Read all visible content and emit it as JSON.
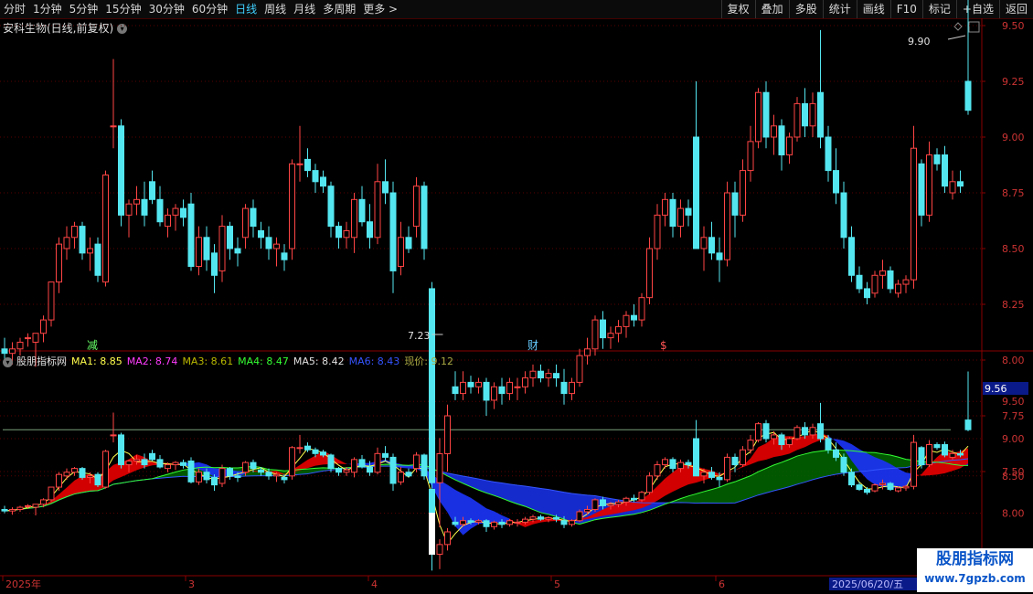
{
  "toolbar": {
    "periods": [
      "分时",
      "1分钟",
      "5分钟",
      "15分钟",
      "30分钟",
      "60分钟",
      "日线",
      "周线",
      "月线",
      "多周期",
      "更多 >"
    ],
    "active_period": "日线",
    "right_buttons": [
      "复权",
      "叠加",
      "多股",
      "统计",
      "画线",
      "F10",
      "标记",
      "+自选",
      "返回"
    ]
  },
  "main_title": "安科生物(日线,前复权)",
  "sub_indicator": {
    "name": "股朋指标网",
    "labels": [
      {
        "text": "MA1: 8.85",
        "color": "#ffff4d"
      },
      {
        "text": "MA2: 8.74",
        "color": "#ff3cff"
      },
      {
        "text": "MA3: 8.61",
        "color": "#b8b800"
      },
      {
        "text": "MA4: 8.47",
        "color": "#33ff33"
      },
      {
        "text": "MA5: 8.42",
        "color": "#e0e0e0"
      },
      {
        "text": "MA6: 8.43",
        "color": "#3355ff"
      },
      {
        "text": "现价: 9.12",
        "color": "#aaaa44"
      }
    ]
  },
  "price_axis": [
    "9.50",
    "9.25",
    "9.00",
    "8.75",
    "8.50",
    "8.25",
    "8.00",
    "7.75",
    "7.50"
  ],
  "sub_axis": [
    "9.50",
    "9.00",
    "8.50",
    "8.00"
  ],
  "sub_current_value": "9.56",
  "high_label": "9.90",
  "low_label": "7.23",
  "event_marks": [
    "减",
    "财",
    "$"
  ],
  "date_labels": [
    "2025年",
    "3",
    "4",
    "5",
    "6"
  ],
  "date_badge": "2025/06/20/五",
  "watermark": {
    "line1": "股朋指标网",
    "line2": "www.7gpzb.com"
  },
  "colors": {
    "up": "#ff4444",
    "down": "#54e6f0",
    "grid": "#5a0000"
  },
  "chart_data": {
    "type": "candlestick",
    "title": "安科生物(日线,前复权)",
    "ylim": [
      7.23,
      9.9
    ],
    "ohlc": [
      [
        8.05,
        8.1,
        8.0,
        8.03
      ],
      [
        8.03,
        8.08,
        7.98,
        8.05
      ],
      [
        8.05,
        8.1,
        8.02,
        8.08
      ],
      [
        8.1,
        8.12,
        8.06,
        8.1
      ],
      [
        8.08,
        8.12,
        7.97,
        8.12
      ],
      [
        8.12,
        8.2,
        8.08,
        8.18
      ],
      [
        8.18,
        8.35,
        8.15,
        8.35
      ],
      [
        8.35,
        8.55,
        8.3,
        8.52
      ],
      [
        8.5,
        8.6,
        8.45,
        8.55
      ],
      [
        8.55,
        8.62,
        8.5,
        8.6
      ],
      [
        8.6,
        8.62,
        8.45,
        8.48
      ],
      [
        8.48,
        8.55,
        8.4,
        8.5
      ],
      [
        8.52,
        8.55,
        8.35,
        8.38
      ],
      [
        8.35,
        8.85,
        8.33,
        8.83
      ],
      [
        9.05,
        9.35,
        8.95,
        9.05
      ],
      [
        9.05,
        9.08,
        8.6,
        8.65
      ],
      [
        8.65,
        8.72,
        8.55,
        8.7
      ],
      [
        8.7,
        8.78,
        8.65,
        8.72
      ],
      [
        8.72,
        8.8,
        8.6,
        8.65
      ],
      [
        8.8,
        8.85,
        8.7,
        8.72
      ],
      [
        8.72,
        8.78,
        8.6,
        8.62
      ],
      [
        8.6,
        8.68,
        8.55,
        8.65
      ],
      [
        8.65,
        8.7,
        8.58,
        8.68
      ],
      [
        8.68,
        8.72,
        8.6,
        8.64
      ],
      [
        8.7,
        8.75,
        8.4,
        8.42
      ],
      [
        8.42,
        8.6,
        8.38,
        8.55
      ],
      [
        8.55,
        8.6,
        8.4,
        8.45
      ],
      [
        8.48,
        8.52,
        8.3,
        8.38
      ],
      [
        8.4,
        8.65,
        8.35,
        8.6
      ],
      [
        8.6,
        8.62,
        8.45,
        8.5
      ],
      [
        8.5,
        8.55,
        8.42,
        8.48
      ],
      [
        8.55,
        8.7,
        8.5,
        8.68
      ],
      [
        8.68,
        8.72,
        8.55,
        8.6
      ],
      [
        8.58,
        8.62,
        8.5,
        8.55
      ],
      [
        8.55,
        8.6,
        8.45,
        8.5
      ],
      [
        8.5,
        8.55,
        8.42,
        8.52
      ],
      [
        8.48,
        8.52,
        8.4,
        8.45
      ],
      [
        8.5,
        8.9,
        8.45,
        8.88
      ],
      [
        8.88,
        9.05,
        8.8,
        8.88
      ],
      [
        8.9,
        8.95,
        8.82,
        8.85
      ],
      [
        8.85,
        8.88,
        8.75,
        8.8
      ],
      [
        8.82,
        8.85,
        8.75,
        8.78
      ],
      [
        8.78,
        8.8,
        8.55,
        8.6
      ],
      [
        8.6,
        8.62,
        8.5,
        8.55
      ],
      [
        8.55,
        8.62,
        8.5,
        8.58
      ],
      [
        8.55,
        8.75,
        8.48,
        8.72
      ],
      [
        8.72,
        8.78,
        8.6,
        8.62
      ],
      [
        8.62,
        8.7,
        8.5,
        8.55
      ],
      [
        8.55,
        8.88,
        8.52,
        8.8
      ],
      [
        8.8,
        8.9,
        8.7,
        8.75
      ],
      [
        8.75,
        8.8,
        8.3,
        8.4
      ],
      [
        8.42,
        8.62,
        8.38,
        8.55
      ],
      [
        8.55,
        8.6,
        8.48,
        8.5
      ],
      [
        8.6,
        8.82,
        8.55,
        8.78
      ],
      [
        8.78,
        8.8,
        8.45,
        8.5
      ],
      [
        8.32,
        8.35,
        7.23,
        7.45
      ],
      [
        7.45,
        7.65,
        7.25,
        7.58
      ],
      [
        7.58,
        7.8,
        7.5,
        7.75
      ],
      [
        7.88,
        7.95,
        7.82,
        7.85
      ],
      [
        7.85,
        7.95,
        7.82,
        7.9
      ],
      [
        7.9,
        7.93,
        7.85,
        7.88
      ],
      [
        7.88,
        7.92,
        7.85,
        7.9
      ],
      [
        7.9,
        7.92,
        7.75,
        7.82
      ],
      [
        7.82,
        7.9,
        7.78,
        7.88
      ],
      [
        7.88,
        7.92,
        7.8,
        7.85
      ],
      [
        7.85,
        7.92,
        7.82,
        7.9
      ],
      [
        7.88,
        7.92,
        7.82,
        7.88
      ],
      [
        7.88,
        7.95,
        7.85,
        7.92
      ],
      [
        7.92,
        7.98,
        7.88,
        7.95
      ],
      [
        7.95,
        7.98,
        7.9,
        7.92
      ],
      [
        7.92,
        7.96,
        7.88,
        7.94
      ],
      [
        7.94,
        7.98,
        7.88,
        7.92
      ],
      [
        7.9,
        7.96,
        7.8,
        7.85
      ],
      [
        7.85,
        7.92,
        7.82,
        7.9
      ],
      [
        7.9,
        8.05,
        7.88,
        8.02
      ],
      [
        8.02,
        8.1,
        7.98,
        8.05
      ],
      [
        8.05,
        8.2,
        8.02,
        8.18
      ],
      [
        8.18,
        8.22,
        8.05,
        8.1
      ],
      [
        8.1,
        8.15,
        8.05,
        8.12
      ],
      [
        8.12,
        8.18,
        8.08,
        8.15
      ],
      [
        8.15,
        8.22,
        8.1,
        8.2
      ],
      [
        8.2,
        8.25,
        8.15,
        8.18
      ],
      [
        8.18,
        8.3,
        8.15,
        8.28
      ],
      [
        8.28,
        8.55,
        8.25,
        8.5
      ],
      [
        8.5,
        8.7,
        8.45,
        8.65
      ],
      [
        8.65,
        8.75,
        8.6,
        8.72
      ],
      [
        8.72,
        8.75,
        8.55,
        8.6
      ],
      [
        8.6,
        8.72,
        8.55,
        8.68
      ],
      [
        8.68,
        8.72,
        8.6,
        8.65
      ],
      [
        9.0,
        9.25,
        8.5,
        8.5
      ],
      [
        8.5,
        8.6,
        8.4,
        8.55
      ],
      [
        8.55,
        8.62,
        8.45,
        8.48
      ],
      [
        8.48,
        8.55,
        8.35,
        8.45
      ],
      [
        8.45,
        8.8,
        8.42,
        8.75
      ],
      [
        8.75,
        8.8,
        8.55,
        8.65
      ],
      [
        8.65,
        8.9,
        8.62,
        8.85
      ],
      [
        8.85,
        9.05,
        8.8,
        8.98
      ],
      [
        8.98,
        9.22,
        8.95,
        9.2
      ],
      [
        9.2,
        9.25,
        8.95,
        9.0
      ],
      [
        9.0,
        9.1,
        8.92,
        9.05
      ],
      [
        9.05,
        9.08,
        8.85,
        8.92
      ],
      [
        8.92,
        9.02,
        8.88,
        9.0
      ],
      [
        9.0,
        9.18,
        8.98,
        9.15
      ],
      [
        9.15,
        9.22,
        9.0,
        9.05
      ],
      [
        9.05,
        9.2,
        9.0,
        9.15
      ],
      [
        9.2,
        9.48,
        8.95,
        9.0
      ],
      [
        9.0,
        9.05,
        8.8,
        8.85
      ],
      [
        8.85,
        8.95,
        8.7,
        8.75
      ],
      [
        8.75,
        8.8,
        8.5,
        8.55
      ],
      [
        8.55,
        8.6,
        8.35,
        8.38
      ],
      [
        8.38,
        8.42,
        8.3,
        8.32
      ],
      [
        8.32,
        8.35,
        8.25,
        8.28
      ],
      [
        8.3,
        8.4,
        8.28,
        8.38
      ],
      [
        8.38,
        8.45,
        8.32,
        8.4
      ],
      [
        8.4,
        8.42,
        8.3,
        8.32
      ],
      [
        8.3,
        8.36,
        8.28,
        8.34
      ],
      [
        8.34,
        8.38,
        8.3,
        8.36
      ],
      [
        8.36,
        9.05,
        8.32,
        8.95
      ],
      [
        8.88,
        8.9,
        8.6,
        8.65
      ],
      [
        8.65,
        8.98,
        8.62,
        8.92
      ],
      [
        8.92,
        8.95,
        8.85,
        8.88
      ],
      [
        8.92,
        8.96,
        8.75,
        8.78
      ],
      [
        8.75,
        8.85,
        8.72,
        8.8
      ],
      [
        8.8,
        8.85,
        8.75,
        8.78
      ],
      [
        9.25,
        9.9,
        9.1,
        9.12
      ]
    ]
  }
}
